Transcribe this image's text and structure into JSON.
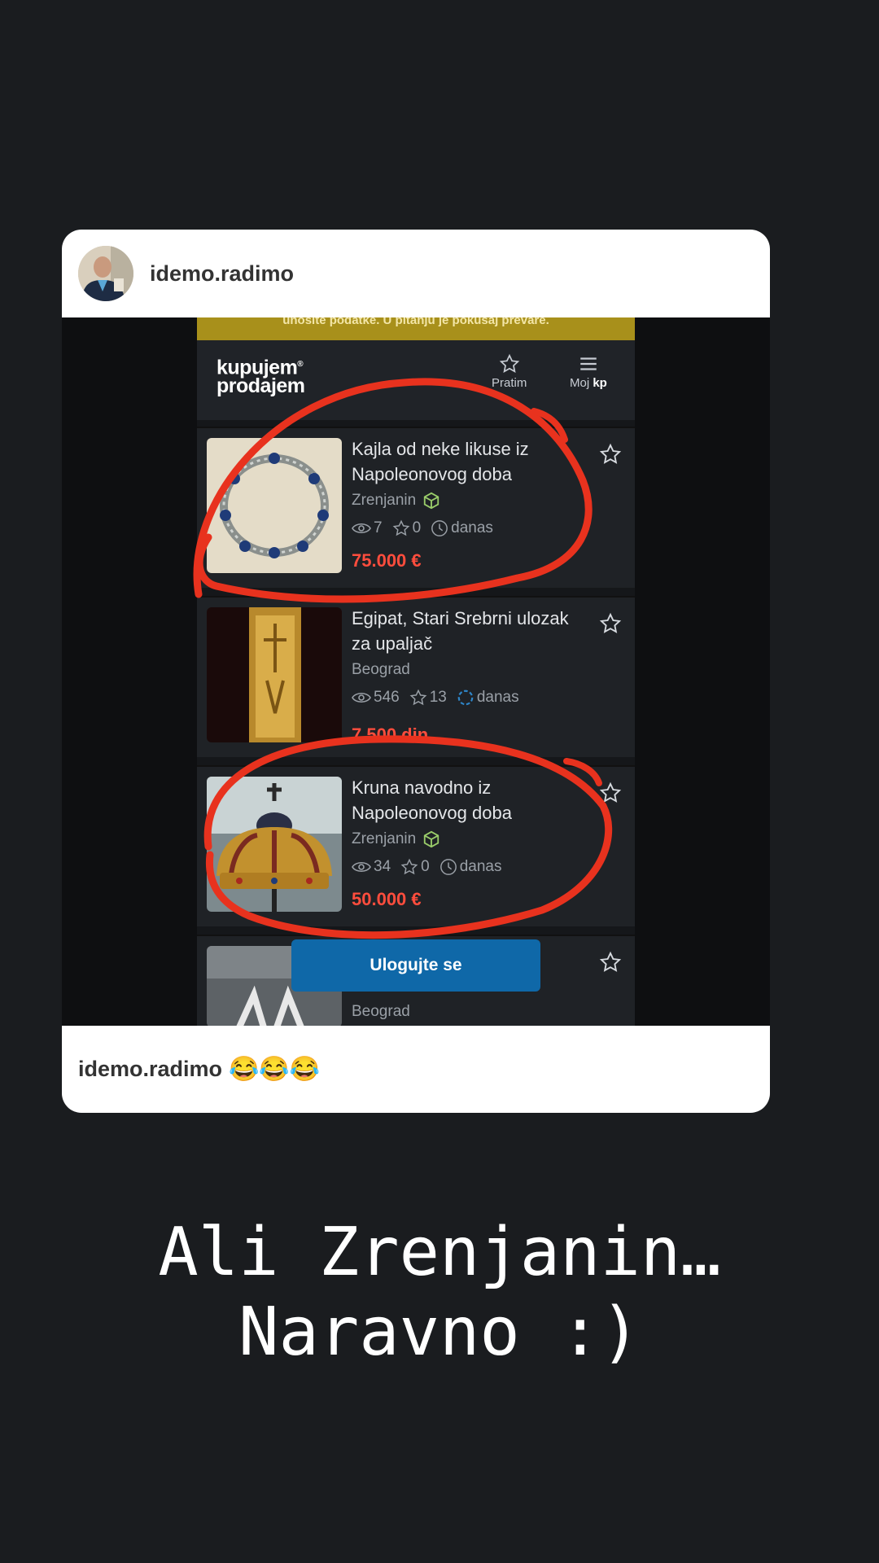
{
  "post": {
    "username": "idemo.radimo",
    "caption_user": "idemo.radimo",
    "caption_emoji": "😂😂😂"
  },
  "screenshot": {
    "warning_text": "unosite podatke. U pitanju je pokušaj prevare.",
    "logo_line1": "kupujem",
    "logo_line2": "prodajem",
    "nav_follow": "Pratim",
    "nav_my_prefix": "Moj",
    "nav_my_suffix": "kp",
    "login_button": "Ulogujte se",
    "listings": [
      {
        "title": "Kajla od neke likuse iz Napoleonovog doba",
        "city": "Zrenjanin",
        "views": "7",
        "stars": "0",
        "time": "danas",
        "price": "75.000 €"
      },
      {
        "title": "Egipat, Stari Srebrni ulozak za upaljač",
        "city": "Beograd",
        "views": "546",
        "stars": "13",
        "time": "danas",
        "price": "7.500 din"
      },
      {
        "title": "Kruna navodno iz Napoleonovog doba",
        "city": "Zrenjanin",
        "views": "34",
        "stars": "0",
        "time": "danas",
        "price": "50.000 €"
      },
      {
        "title": "",
        "city": "Beograd",
        "views": "",
        "stars": "",
        "time": "",
        "price": ""
      }
    ]
  },
  "story": {
    "line1": "Ali Zrenjanin…",
    "line2": "Naravno :)"
  },
  "colors": {
    "background": "#1a1c1f",
    "price": "#ff4d3d",
    "marker": "#e8321e",
    "login": "#0f68a8"
  }
}
